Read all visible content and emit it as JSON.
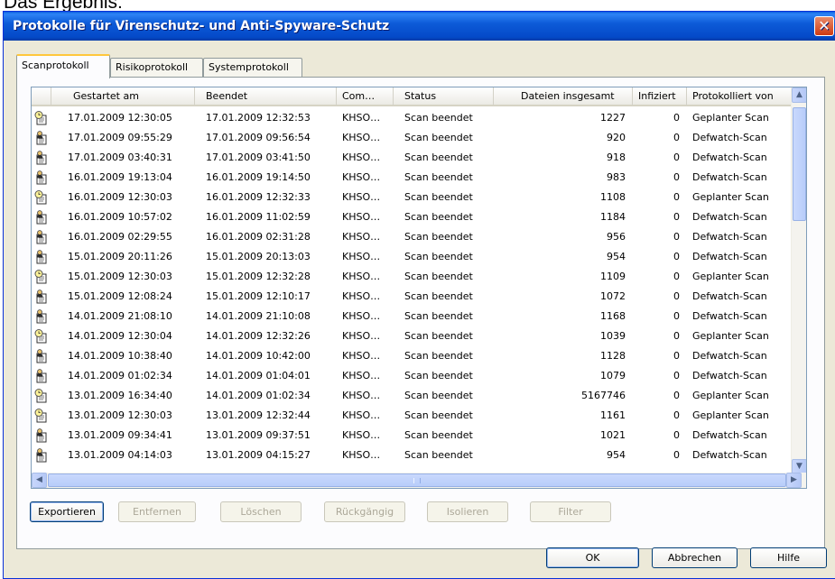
{
  "caption": "Das Ergebnis:",
  "window": {
    "title": "Protokolle für Virenschutz- und Anti-Spyware-Schutz",
    "close_glyph": "✕"
  },
  "tabs": [
    {
      "label": "Scanprotokoll",
      "active": true
    },
    {
      "label": "Risikoprotokoll",
      "active": false
    },
    {
      "label": "Systemprotokoll",
      "active": false
    }
  ],
  "columns": [
    "",
    "Gestartet am",
    "Beendet",
    "Com…",
    "Status",
    "Dateien insgesamt",
    "Infiziert",
    "Protokolliert von"
  ],
  "rows": [
    {
      "icon": "clock-doc-icon",
      "start": "17.01.2009 12:30:05",
      "end": "17.01.2009 12:32:53",
      "comp": "KHSO…",
      "status": "Scan beendet",
      "files": "1227",
      "infected": "0",
      "by": "Geplanter Scan"
    },
    {
      "icon": "person-doc-icon",
      "start": "17.01.2009 09:55:29",
      "end": "17.01.2009 09:56:54",
      "comp": "KHSO…",
      "status": "Scan beendet",
      "files": "920",
      "infected": "0",
      "by": "Defwatch-Scan"
    },
    {
      "icon": "person-doc-icon",
      "start": "17.01.2009 03:40:31",
      "end": "17.01.2009 03:41:50",
      "comp": "KHSO…",
      "status": "Scan beendet",
      "files": "918",
      "infected": "0",
      "by": "Defwatch-Scan"
    },
    {
      "icon": "person-doc-icon",
      "start": "16.01.2009 19:13:04",
      "end": "16.01.2009 19:14:50",
      "comp": "KHSO…",
      "status": "Scan beendet",
      "files": "983",
      "infected": "0",
      "by": "Defwatch-Scan"
    },
    {
      "icon": "clock-doc-icon",
      "start": "16.01.2009 12:30:03",
      "end": "16.01.2009 12:32:33",
      "comp": "KHSO…",
      "status": "Scan beendet",
      "files": "1108",
      "infected": "0",
      "by": "Geplanter Scan"
    },
    {
      "icon": "person-doc-icon",
      "start": "16.01.2009 10:57:02",
      "end": "16.01.2009 11:02:59",
      "comp": "KHSO…",
      "status": "Scan beendet",
      "files": "1184",
      "infected": "0",
      "by": "Defwatch-Scan"
    },
    {
      "icon": "person-doc-icon",
      "start": "16.01.2009 02:29:55",
      "end": "16.01.2009 02:31:28",
      "comp": "KHSO…",
      "status": "Scan beendet",
      "files": "956",
      "infected": "0",
      "by": "Defwatch-Scan"
    },
    {
      "icon": "person-doc-icon",
      "start": "15.01.2009 20:11:26",
      "end": "15.01.2009 20:13:03",
      "comp": "KHSO…",
      "status": "Scan beendet",
      "files": "954",
      "infected": "0",
      "by": "Defwatch-Scan"
    },
    {
      "icon": "clock-doc-icon",
      "start": "15.01.2009 12:30:03",
      "end": "15.01.2009 12:32:28",
      "comp": "KHSO…",
      "status": "Scan beendet",
      "files": "1109",
      "infected": "0",
      "by": "Geplanter Scan"
    },
    {
      "icon": "person-doc-icon",
      "start": "15.01.2009 12:08:24",
      "end": "15.01.2009 12:10:17",
      "comp": "KHSO…",
      "status": "Scan beendet",
      "files": "1072",
      "infected": "0",
      "by": "Defwatch-Scan"
    },
    {
      "icon": "person-doc-icon",
      "start": "14.01.2009 21:08:10",
      "end": "14.01.2009 21:10:08",
      "comp": "KHSO…",
      "status": "Scan beendet",
      "files": "1168",
      "infected": "0",
      "by": "Defwatch-Scan"
    },
    {
      "icon": "clock-doc-icon",
      "start": "14.01.2009 12:30:04",
      "end": "14.01.2009 12:32:26",
      "comp": "KHSO…",
      "status": "Scan beendet",
      "files": "1039",
      "infected": "0",
      "by": "Geplanter Scan"
    },
    {
      "icon": "person-doc-icon",
      "start": "14.01.2009 10:38:40",
      "end": "14.01.2009 10:42:00",
      "comp": "KHSO…",
      "status": "Scan beendet",
      "files": "1128",
      "infected": "0",
      "by": "Defwatch-Scan"
    },
    {
      "icon": "person-doc-icon",
      "start": "14.01.2009 01:02:34",
      "end": "14.01.2009 01:04:01",
      "comp": "KHSO…",
      "status": "Scan beendet",
      "files": "1079",
      "infected": "0",
      "by": "Defwatch-Scan"
    },
    {
      "icon": "clock-doc-icon",
      "start": "13.01.2009 16:34:40",
      "end": "14.01.2009 01:02:34",
      "comp": "KHSO…",
      "status": "Scan beendet",
      "files": "5167746",
      "infected": "0",
      "by": "Geplanter Scan"
    },
    {
      "icon": "clock-doc-icon",
      "start": "13.01.2009 12:30:03",
      "end": "13.01.2009 12:32:44",
      "comp": "KHSO…",
      "status": "Scan beendet",
      "files": "1161",
      "infected": "0",
      "by": "Geplanter Scan"
    },
    {
      "icon": "person-doc-icon",
      "start": "13.01.2009 09:34:41",
      "end": "13.01.2009 09:37:51",
      "comp": "KHSO…",
      "status": "Scan beendet",
      "files": "1021",
      "infected": "0",
      "by": "Defwatch-Scan"
    },
    {
      "icon": "person-doc-icon",
      "start": "13.01.2009 04:14:03",
      "end": "13.01.2009 04:15:27",
      "comp": "KHSO…",
      "status": "Scan beendet",
      "files": "954",
      "infected": "0",
      "by": "Defwatch-Scan"
    }
  ],
  "scroll": {
    "up": "▲",
    "down": "▼",
    "left": "◀",
    "right": "▶"
  },
  "actions": [
    {
      "label": "Exportieren",
      "enabled": true
    },
    {
      "label": "Entfernen",
      "enabled": false
    },
    {
      "label": "Löschen",
      "enabled": false
    },
    {
      "label": "Rückgängig",
      "enabled": false
    },
    {
      "label": "Isolieren",
      "enabled": false
    },
    {
      "label": "Filter",
      "enabled": false
    }
  ],
  "dialog_buttons": {
    "ok": "OK",
    "cancel": "Abbrechen",
    "help": "Hilfe"
  }
}
